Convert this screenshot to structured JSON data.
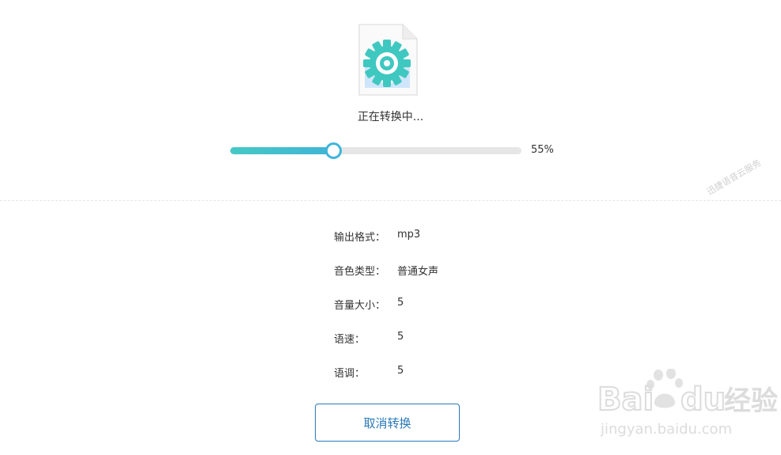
{
  "status_text": "正在转换中...",
  "progress": {
    "value": 0.55,
    "percent_label": "55%"
  },
  "watermark_side": "迅捷语音云服务",
  "info": [
    {
      "label": "输出格式：",
      "value": "mp3"
    },
    {
      "label": "音色类型：",
      "value": "普通女声"
    },
    {
      "label": "音量大小：",
      "value": "5"
    },
    {
      "label": "语速：",
      "value": "5"
    },
    {
      "label": "语调：",
      "value": "5"
    }
  ],
  "cancel_label": "取消转换",
  "baidu_watermark": {
    "brand": "Bai du",
    "suffix": "经验",
    "url": "jingyan.baidu.com"
  },
  "colors": {
    "accent": "#3eb4db",
    "teal": "#45c9c5",
    "button": "#2a79b8",
    "track": "#e6e6e6"
  },
  "icons": {
    "file": "file-gear-icon"
  }
}
